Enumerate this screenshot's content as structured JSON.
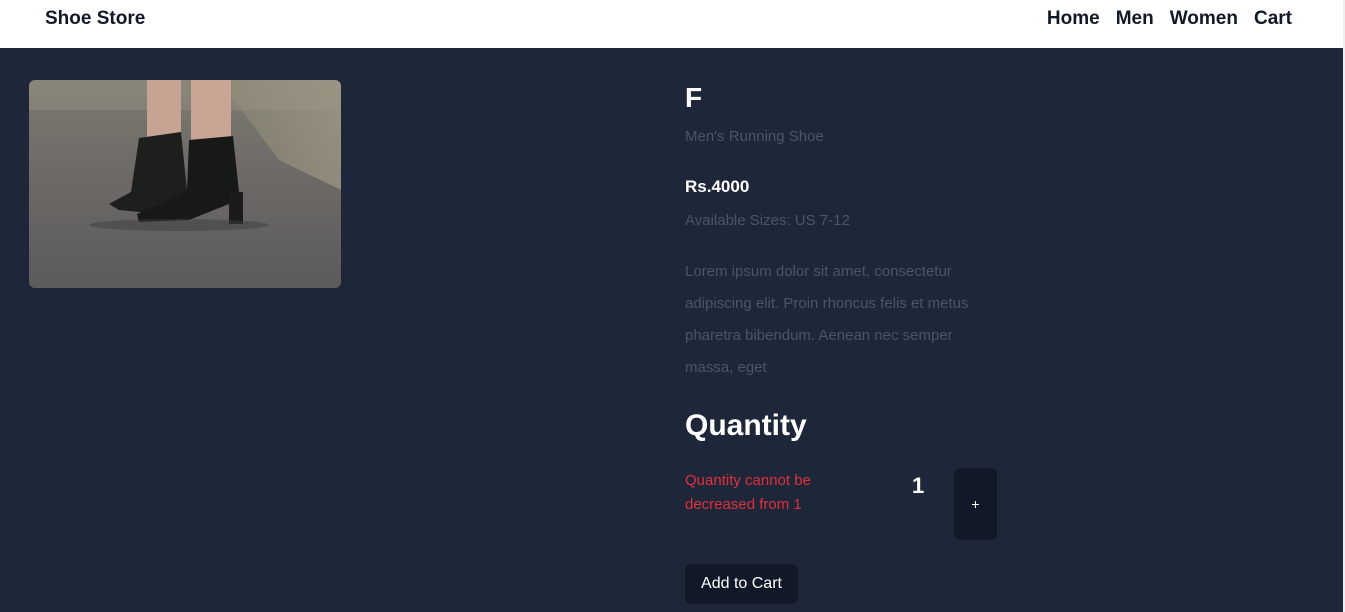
{
  "navbar": {
    "brand": "Shoe Store",
    "links": [
      "Home",
      "Men",
      "Women",
      "Cart"
    ]
  },
  "product": {
    "name": "F",
    "subtitle": "Men's Running Shoe",
    "price": "Rs.4000",
    "sizes": "Available Sizes: US 7-12",
    "description": "Lorem ipsum dolor sit amet, consectetur adipiscing elit. Proin rhoncus felis et metus pharetra bibendum. Aenean nec semper massa, eget",
    "image_icon": "product-photo-black-ankle-boots"
  },
  "quantity": {
    "heading": "Quantity",
    "error": "Quantity cannot be decreased from 1",
    "value": "1",
    "plus_label": "+"
  },
  "cart": {
    "add_label": "Add to Cart"
  },
  "colors": {
    "background": "#1e2639",
    "navbar": "#ffffff",
    "button": "#111827",
    "error": "#e0303a",
    "muted_text": "#4b5567"
  }
}
